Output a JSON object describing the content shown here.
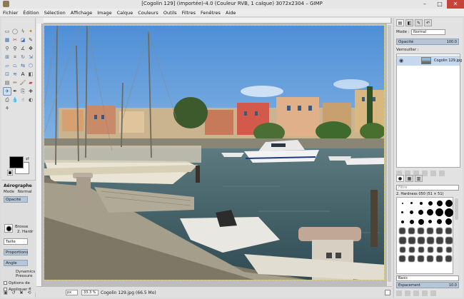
{
  "window": {
    "title": "[Cogolin 129] (importée)-4.0 (Couleur RVB, 1 calque) 3072x2304 – GIMP",
    "minimize": "–",
    "maximize": "□",
    "close": "✕"
  },
  "menu": [
    "Fichier",
    "Édition",
    "Sélection",
    "Affichage",
    "Image",
    "Calque",
    "Couleurs",
    "Outils",
    "Filtres",
    "Fenêtres",
    "Aide"
  ],
  "toolbox": {
    "tools": [
      {
        "icon": "rect-select-icon",
        "glyph": "▭",
        "color": "#555"
      },
      {
        "icon": "ellipse-select-icon",
        "glyph": "◯",
        "color": "#555"
      },
      {
        "icon": "free-select-icon",
        "glyph": "ϟ",
        "color": "#555"
      },
      {
        "icon": "fuzzy-select-icon",
        "glyph": "✦",
        "color": "#c07a00"
      },
      {
        "icon": "by-color-select-icon",
        "glyph": "▦",
        "color": "#3a6fb0"
      },
      {
        "icon": "scissors-icon",
        "glyph": "✂",
        "color": "#b03a3a"
      },
      {
        "icon": "foreground-select-icon",
        "glyph": "◪",
        "color": "#3a6fb0"
      },
      {
        "icon": "paths-icon",
        "glyph": "✎",
        "color": "#444"
      },
      {
        "icon": "color-picker-icon",
        "glyph": "⚲",
        "color": "#555"
      },
      {
        "icon": "zoom-icon",
        "glyph": "⚲",
        "color": "#333"
      },
      {
        "icon": "measure-icon",
        "glyph": "∡",
        "color": "#555"
      },
      {
        "icon": "move-icon",
        "glyph": "✥",
        "color": "#333"
      },
      {
        "icon": "align-icon",
        "glyph": "⊞",
        "color": "#3a6fb0"
      },
      {
        "icon": "crop-icon",
        "glyph": "⌗",
        "color": "#555"
      },
      {
        "icon": "rotate-icon",
        "glyph": "↻",
        "color": "#3a6fb0"
      },
      {
        "icon": "scale-icon",
        "glyph": "⇲",
        "color": "#3a6fb0"
      },
      {
        "icon": "shear-icon",
        "glyph": "▱",
        "color": "#3a6fb0"
      },
      {
        "icon": "perspective-icon",
        "glyph": "⏢",
        "color": "#3a6fb0"
      },
      {
        "icon": "flip-icon",
        "glyph": "⇆",
        "color": "#3a6fb0"
      },
      {
        "icon": "cage-icon",
        "glyph": "⬡",
        "color": "#3a6fb0"
      },
      {
        "icon": "unified-transform-icon",
        "glyph": "⊡",
        "color": "#3a6fb0"
      },
      {
        "icon": "warp-icon",
        "glyph": "≋",
        "color": "#3a6fb0"
      },
      {
        "icon": "text-icon",
        "glyph": "A",
        "color": "#111"
      },
      {
        "icon": "bucket-fill-icon",
        "glyph": "◧",
        "color": "#555"
      },
      {
        "icon": "blend-icon",
        "glyph": "▤",
        "color": "#555"
      },
      {
        "icon": "pencil-icon",
        "glyph": "✏",
        "color": "#8a6d2a"
      },
      {
        "icon": "paintbrush-icon",
        "glyph": "🖌",
        "color": "#8a6d2a"
      },
      {
        "icon": "eraser-icon",
        "glyph": "▰",
        "color": "#c44"
      },
      {
        "icon": "airbrush-icon",
        "glyph": "✈",
        "color": "#555",
        "active": true
      },
      {
        "icon": "ink-icon",
        "glyph": "✒",
        "color": "#333"
      },
      {
        "icon": "clone-icon",
        "glyph": "⎘",
        "color": "#555"
      },
      {
        "icon": "heal-icon",
        "glyph": "✚",
        "color": "#555"
      },
      {
        "icon": "perspective-clone-icon",
        "glyph": "⎙",
        "color": "#555"
      },
      {
        "icon": "blur-icon",
        "glyph": "💧",
        "color": "#3a6fb0"
      },
      {
        "icon": "smudge-icon",
        "glyph": "☝",
        "color": "#555"
      },
      {
        "icon": "dodge-burn-icon",
        "glyph": "◐",
        "color": "#555"
      },
      {
        "icon": "mypaint-brush-icon",
        "glyph": "⚘",
        "color": "#555"
      }
    ],
    "swap_glyph": "⇄"
  },
  "tool_options": {
    "title": "Aérographe",
    "mode_label": "Mode",
    "mode_value": "Normal",
    "opacity_label": "Opacité",
    "brush_label": "Brosse",
    "brush_name": "2. Hardr",
    "size_label": "Taille",
    "proportions_label": "Proportions",
    "angle_label": "Angle",
    "dynamics_label": "Dynamics",
    "dynamics_value": "Pressure",
    "options_label": "Options de",
    "apply_label": "Appliquer fl"
  },
  "canvas": {
    "unit": "px",
    "zoom": "33.3 %",
    "status": "Cogolin 129.jpg (66.5 Mo)"
  },
  "dock": {
    "mode_label": "Mode :",
    "mode_value": "Normal",
    "opacity_label": "Opacité",
    "opacity_value": "100.0",
    "lock_label": "Verrouiller :",
    "layer_name": "Cogolin 129.jpg",
    "brush_filter": "Filtre",
    "brush_selected": "2. Hardness 050 (51 × 51)",
    "brush_preset": "Basic",
    "spacing_label": "Espacement",
    "spacing_value": "10.0"
  }
}
